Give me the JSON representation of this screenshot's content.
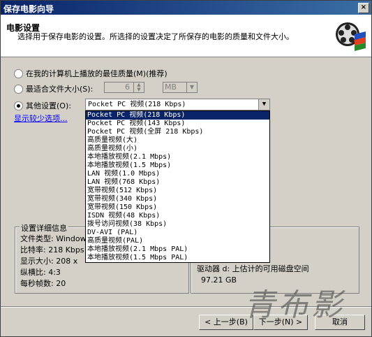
{
  "window": {
    "title": "保存电影向导",
    "close": "×"
  },
  "header": {
    "title": "电影设置",
    "description": "选择用于保存电影的设置。所选择的设置决定了所保存的电影的质量和文件大小。"
  },
  "options": {
    "best_quality": "在我的计算机上播放的最佳质量(M)(推荐)",
    "fit_size": "最适合文件大小(S):",
    "fit_size_value": "6",
    "fit_size_unit": "MB",
    "other": "其他设置(O):",
    "other_selected": "Pocket PC 视频(218 Kbps)",
    "show_less": "显示较少选项..."
  },
  "dropdown": {
    "items": [
      "Pocket PC 视频(218 Kbps)",
      "Pocket PC 视频(143 Kbps)",
      "Pocket PC 视频(全屏 218 Kbps)",
      "高质量视频(大)",
      "高质量视频(小)",
      "本地播放视频(2.1 Mbps)",
      "本地播放视频(1.5 Mbps)",
      "LAN 视频(1.0 Mbps)",
      "LAN 视频(768 Kbps)",
      "宽带视频(512 Kbps)",
      "宽带视频(340 Kbps)",
      "宽带视频(150 Kbps)",
      "ISDN 视频(48 Kbps)",
      "拨号访问视频(38 Kbps)",
      "DV-AVI (PAL)",
      "高质量视频(PAL)",
      "本地播放视频(2.1 Mbps PAL)",
      "本地播放视频(1.5 Mbps PAL)"
    ]
  },
  "details": {
    "label": "设置详细信息",
    "file_type": "文件类型: Windows",
    "bitrate": "比特率: 218 Kbps",
    "display_size": "显示大小: 208 x",
    "aspect": "纵横比: 4:3",
    "fps": "每秒帧数: 20"
  },
  "drive": {
    "line1": "驱动器 d: 上估计的可用磁盘空间",
    "line2": "97.21 GB"
  },
  "buttons": {
    "back": "< 上一步(B)",
    "next": "下一步(N) >",
    "cancel": "取消"
  },
  "watermark": "青布影"
}
